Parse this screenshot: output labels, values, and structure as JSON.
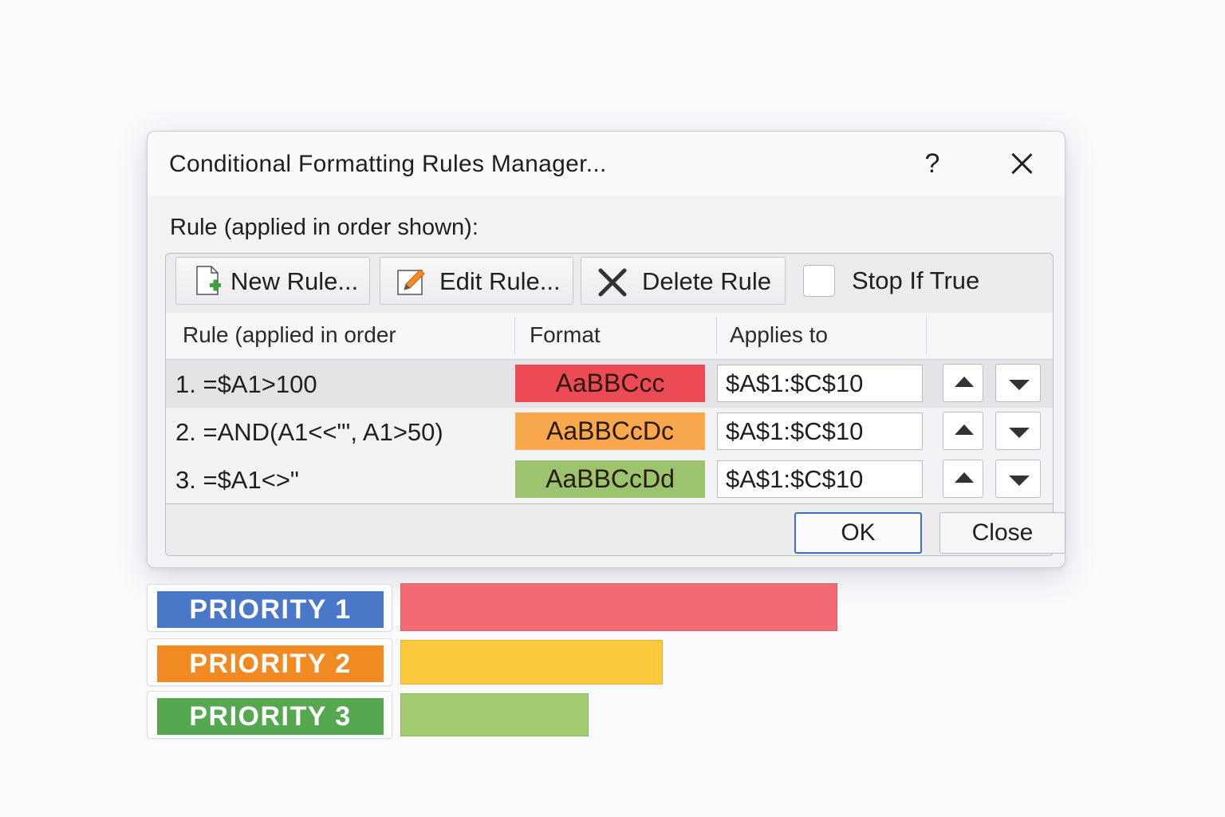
{
  "dialog": {
    "title": "Conditional Formatting Rules Manager...",
    "help": "?",
    "section_label": "Rule (applied in order shown):",
    "toolbar": {
      "new_rule": "New Rule...",
      "edit_rule": "Edit Rule...",
      "delete_rule": "Delete Rule",
      "stop_if_true": "Stop If True",
      "stop_if_true_checked": false
    },
    "columns": {
      "rule": "Rule (applied in order",
      "format": "Format",
      "applies_to": "Applies to"
    },
    "rules": [
      {
        "rule": "1.  =$A1>100",
        "format_preview": "AaBBCcc",
        "format_color": "#ec4a55",
        "applies_to": "$A$1:$C$10"
      },
      {
        "rule": "2.  =AND(A1<<\"', A1>50)",
        "format_preview": "AaBBCcDc",
        "format_color": "#f9a84d",
        "applies_to": "$A$1:$C$10"
      },
      {
        "rule": "3.  =$A1<>\"",
        "format_preview": "AaBBCcDd",
        "format_color": "#9cc46e",
        "applies_to": "$A$1:$C$10"
      }
    ],
    "ok": "OK",
    "close": "Close"
  },
  "priorities": [
    {
      "label": "PRIORITY 1",
      "label_color": "#4a78c8",
      "bar_color": "#f26b74",
      "bar_level": 1.0
    },
    {
      "label": "PRIORITY 2",
      "label_color": "#f08a22",
      "bar_color": "#fcc93f",
      "bar_level": 0.6
    },
    {
      "label": "PRIORITY 3",
      "label_color": "#55a84f",
      "bar_color": "#a4cc72",
      "bar_level": 0.43
    }
  ]
}
